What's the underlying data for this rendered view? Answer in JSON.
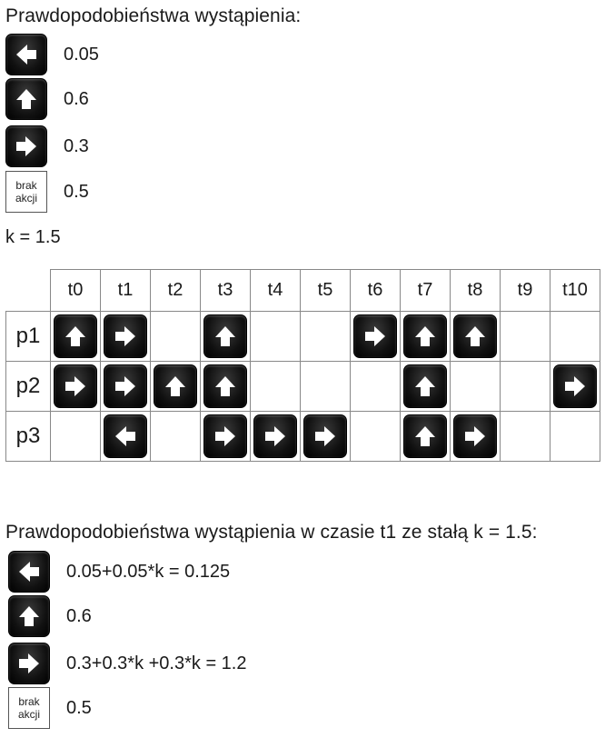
{
  "top": {
    "title": "Prawdopodobieństwa wystąpienia:",
    "items": [
      {
        "icon": "left",
        "value": "0.05"
      },
      {
        "icon": "up",
        "value": "0.6"
      },
      {
        "icon": "right",
        "value": "0.3"
      },
      {
        "icon": "none",
        "label_line1": "brak",
        "label_line2": "akcji",
        "value": "0.5"
      }
    ],
    "k": "k = 1.5"
  },
  "table": {
    "columns": [
      "t0",
      "t1",
      "t2",
      "t3",
      "t4",
      "t5",
      "t6",
      "t7",
      "t8",
      "t9",
      "t10"
    ],
    "rows": [
      {
        "label": "p1",
        "cells": [
          "up",
          "right",
          "",
          "up",
          "",
          "",
          "right",
          "up",
          "up",
          "",
          ""
        ]
      },
      {
        "label": "p2",
        "cells": [
          "right",
          "right",
          "up",
          "up",
          "",
          "",
          "",
          "up",
          "",
          "",
          "right"
        ]
      },
      {
        "label": "p3",
        "cells": [
          "",
          "left",
          "",
          "right",
          "right",
          "right",
          "",
          "up",
          "right",
          "",
          ""
        ]
      }
    ]
  },
  "bottom": {
    "title": "Prawdopodobieństwa wystąpienia w czasie t1 ze stałą k = 1.5:",
    "items": [
      {
        "icon": "left",
        "value": "0.05+0.05*k = 0.125"
      },
      {
        "icon": "up",
        "value": "0.6"
      },
      {
        "icon": "right",
        "value": "0.3+0.3*k +0.3*k = 1.2"
      },
      {
        "icon": "none",
        "label_line1": "brak",
        "label_line2": "akcji",
        "value": "0.5"
      }
    ]
  }
}
